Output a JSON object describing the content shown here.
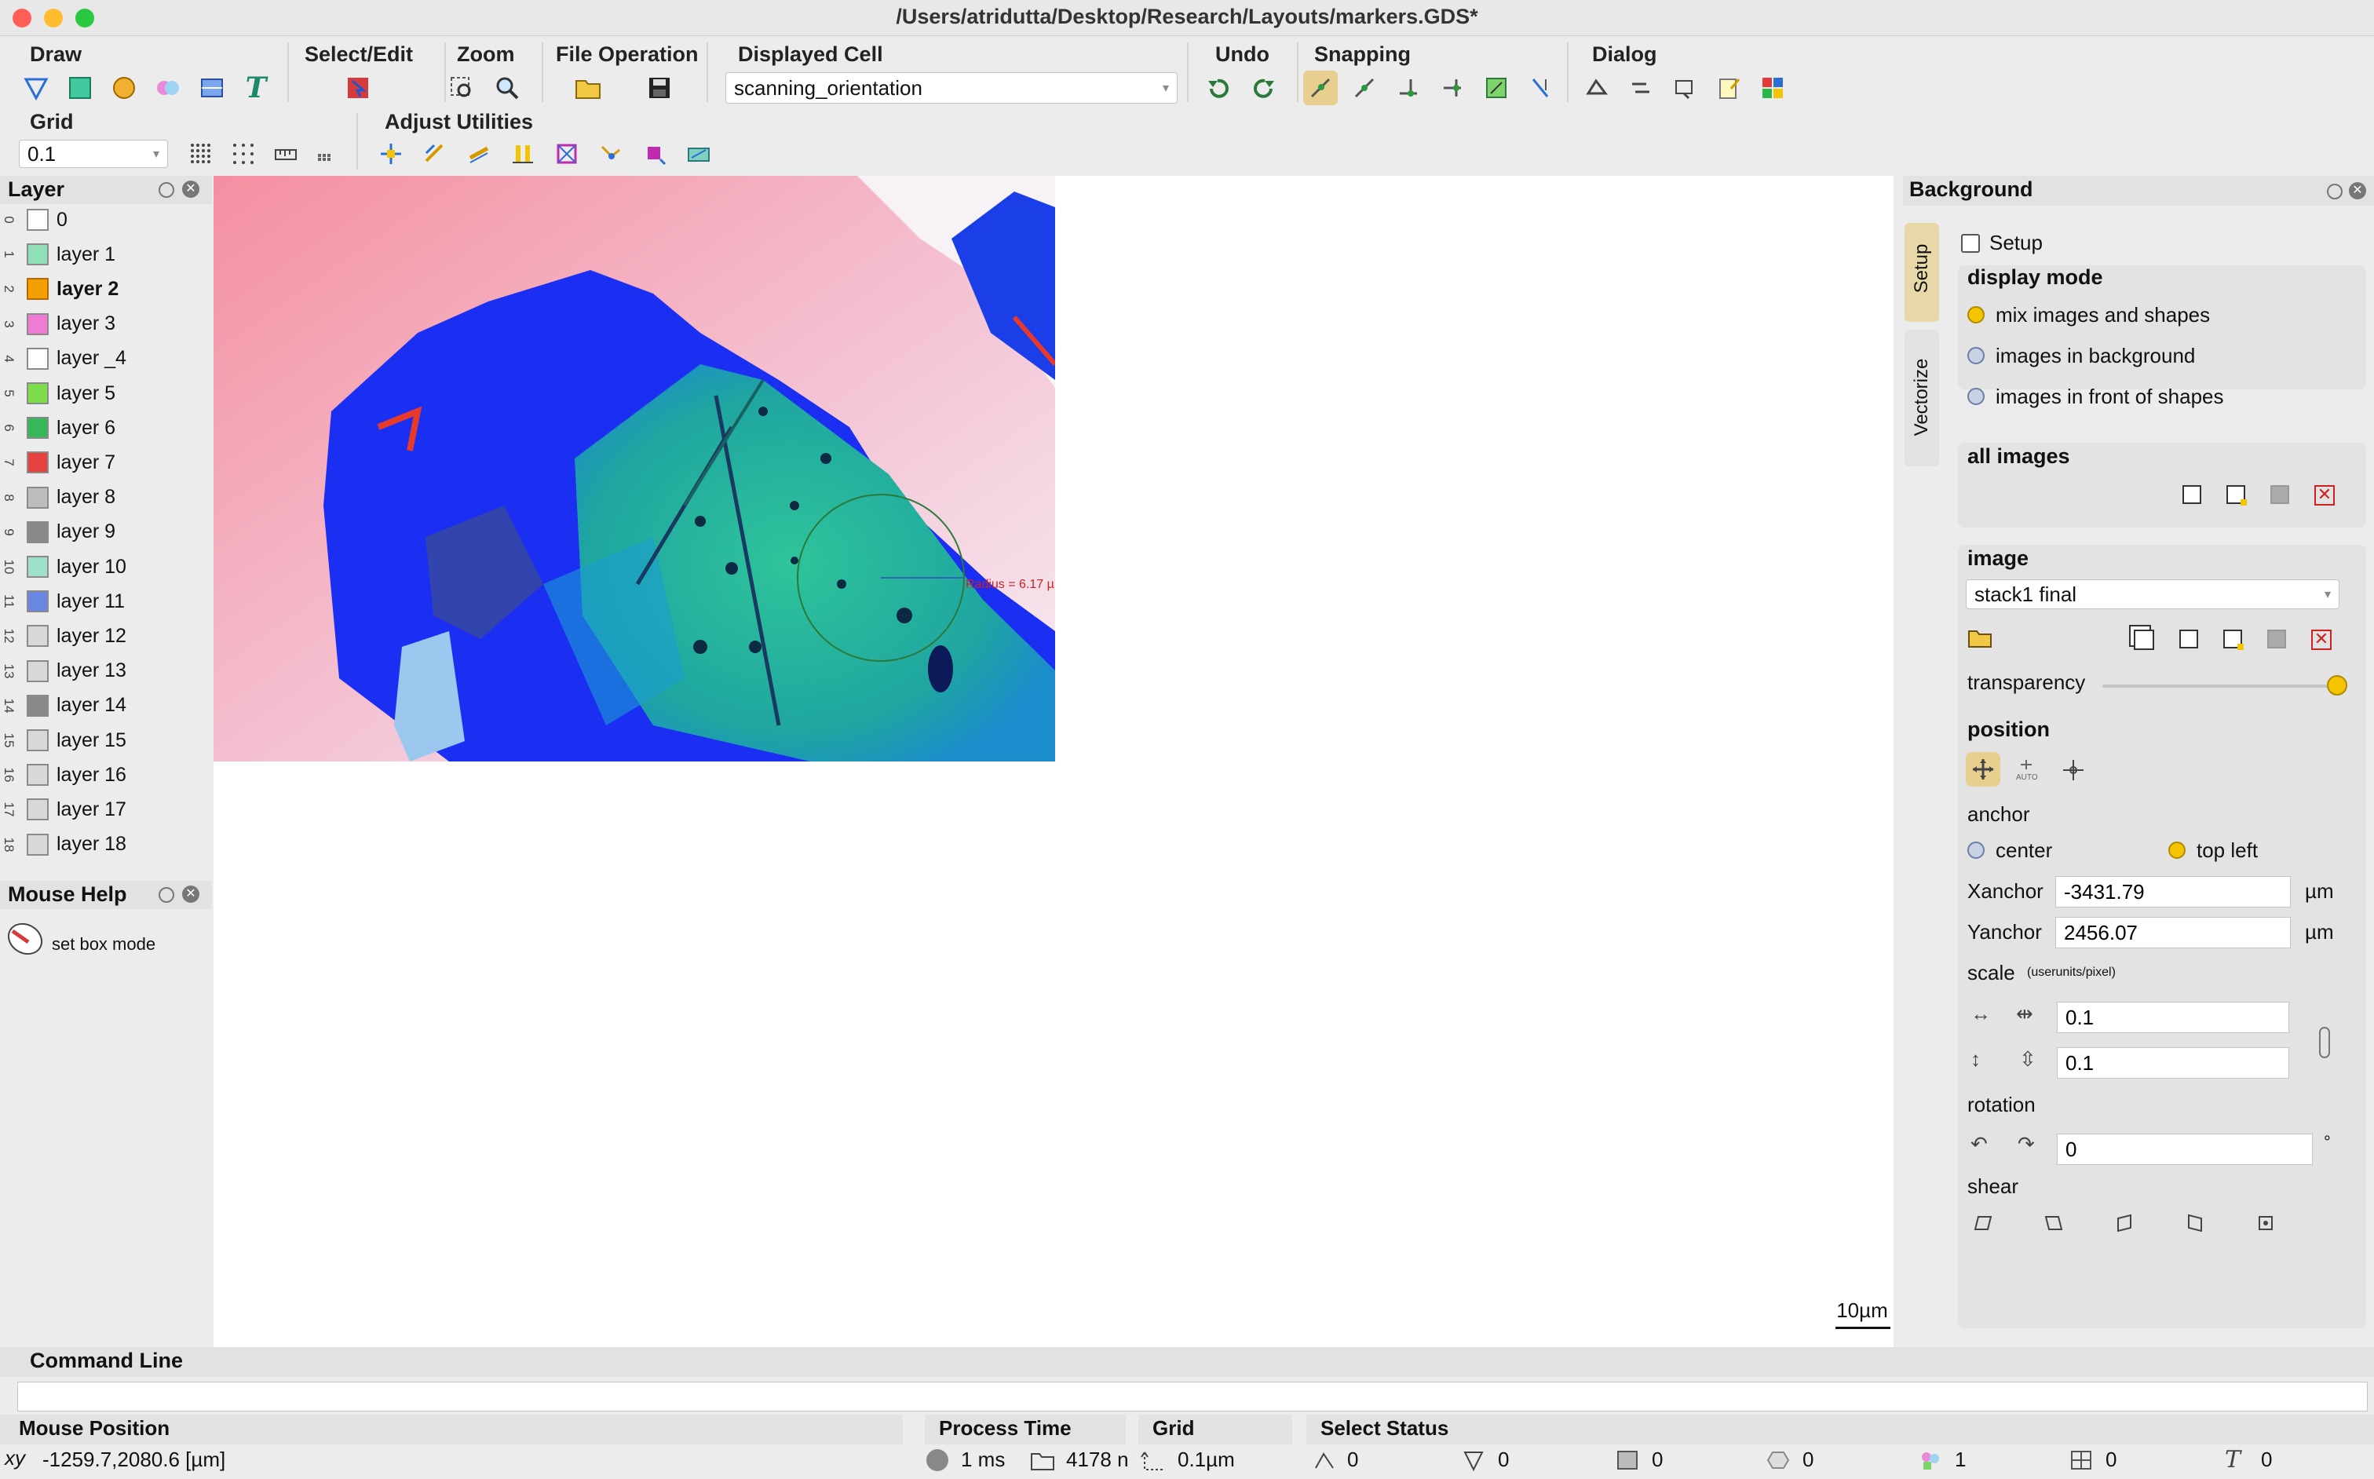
{
  "window": {
    "title": "/Users/atridutta/Desktop/Research/Layouts/markers.GDS*"
  },
  "toolbar": {
    "draw_label": "Draw",
    "select_edit_label": "Select/Edit",
    "zoom_label": "Zoom",
    "file_operation_label": "File Operation",
    "displayed_cell_label": "Displayed Cell",
    "displayed_cell_value": "scanning_orientation",
    "undo_label": "Undo",
    "snapping_label": "Snapping",
    "dialog_label": "Dialog",
    "grid_label": "Grid",
    "grid_value": "0.1",
    "adjust_utilities_label": "Adjust Utilities"
  },
  "layer_panel": {
    "title": "Layer",
    "layers": [
      {
        "num": "0",
        "name": "0",
        "color": "#ffffff",
        "bold": false
      },
      {
        "num": "1",
        "name": "layer 1",
        "color": "#8fe0b8",
        "bold": false
      },
      {
        "num": "2",
        "name": "layer 2",
        "color": "#f2a000",
        "bold": true
      },
      {
        "num": "3",
        "name": "layer 3",
        "color": "#f07bd2",
        "bold": false
      },
      {
        "num": "4",
        "name": "layer _4",
        "color": "#ffffff",
        "bold": false
      },
      {
        "num": "5",
        "name": "layer 5",
        "color": "#7ddc4a",
        "bold": false
      },
      {
        "num": "6",
        "name": "layer 6",
        "color": "#35b85a",
        "bold": false
      },
      {
        "num": "7",
        "name": "layer 7",
        "color": "#e64040",
        "bold": false
      },
      {
        "num": "8",
        "name": "layer 8",
        "color": "#bdbdbd",
        "bold": false
      },
      {
        "num": "9",
        "name": "layer 9",
        "color": "#8a8a8a",
        "bold": false
      },
      {
        "num": "10",
        "name": "layer 10",
        "color": "#9fe0cc",
        "bold": false
      },
      {
        "num": "11",
        "name": "layer 11",
        "color": "#6a86e0",
        "bold": false
      },
      {
        "num": "12",
        "name": "layer 12",
        "color": "#d8d8d8",
        "bold": false
      },
      {
        "num": "13",
        "name": "layer 13",
        "color": "#d8d8d8",
        "bold": false
      },
      {
        "num": "14",
        "name": "layer 14",
        "color": "#8a8a8a",
        "bold": false
      },
      {
        "num": "15",
        "name": "layer 15",
        "color": "#d8d8d8",
        "bold": false
      },
      {
        "num": "16",
        "name": "layer 16",
        "color": "#d8d8d8",
        "bold": false
      },
      {
        "num": "17",
        "name": "layer 17",
        "color": "#d8d8d8",
        "bold": false
      },
      {
        "num": "18",
        "name": "layer 18",
        "color": "#d8d8d8",
        "bold": false
      }
    ]
  },
  "mouse_help": {
    "title": "Mouse Help",
    "text": "set box mode"
  },
  "canvas": {
    "annotation": "Radius = 6.17 µ",
    "scale_bar": "10µm"
  },
  "background_panel": {
    "title": "Background",
    "tab_setup": "Setup",
    "tab_vectorize": "Vectorize",
    "setup_checkbox": "Setup",
    "display_mode": {
      "heading": "display mode",
      "options": [
        "mix images and shapes",
        "images in background",
        "images in front of shapes"
      ],
      "selected": "mix images and shapes"
    },
    "all_images_heading": "all images",
    "image_heading": "image",
    "image_value": "stack1 final",
    "transparency_label": "transparency",
    "transparency_level": 1.0,
    "position_heading": "position",
    "anchor_label": "anchor",
    "anchor_center": "center",
    "anchor_top_left": "top left",
    "anchor_selected": "top left",
    "xanchor_label": "Xanchor",
    "xanchor_value": "-3431.79",
    "yanchor_label": "Yanchor",
    "yanchor_value": "2456.07",
    "unit": "µm",
    "scale_label": "scale",
    "scale_hint": "(userunits/pixel)",
    "scale_x": "0.1",
    "scale_y": "0.1",
    "rotation_label": "rotation",
    "rotation_value": "0",
    "rotation_unit": "°",
    "shear_label": "shear"
  },
  "command_line": {
    "title": "Command Line",
    "value": ""
  },
  "status": {
    "mouse_position_label": "Mouse Position",
    "mouse_position_value": "-1259.7,2080.6 [µm]",
    "process_time_label": "Process Time",
    "process_time_value": "1 ms",
    "process_count_value": "4178 n",
    "grid_label": "Grid",
    "grid_value": "0.1µm",
    "select_status_label": "Select Status",
    "select_counts": [
      "0",
      "0",
      "0",
      "0",
      "1",
      "0",
      "0"
    ]
  },
  "colors": {
    "accent": "#f5c400",
    "canvas_bg": "#ffffff",
    "panel_bg": "#ececec"
  }
}
